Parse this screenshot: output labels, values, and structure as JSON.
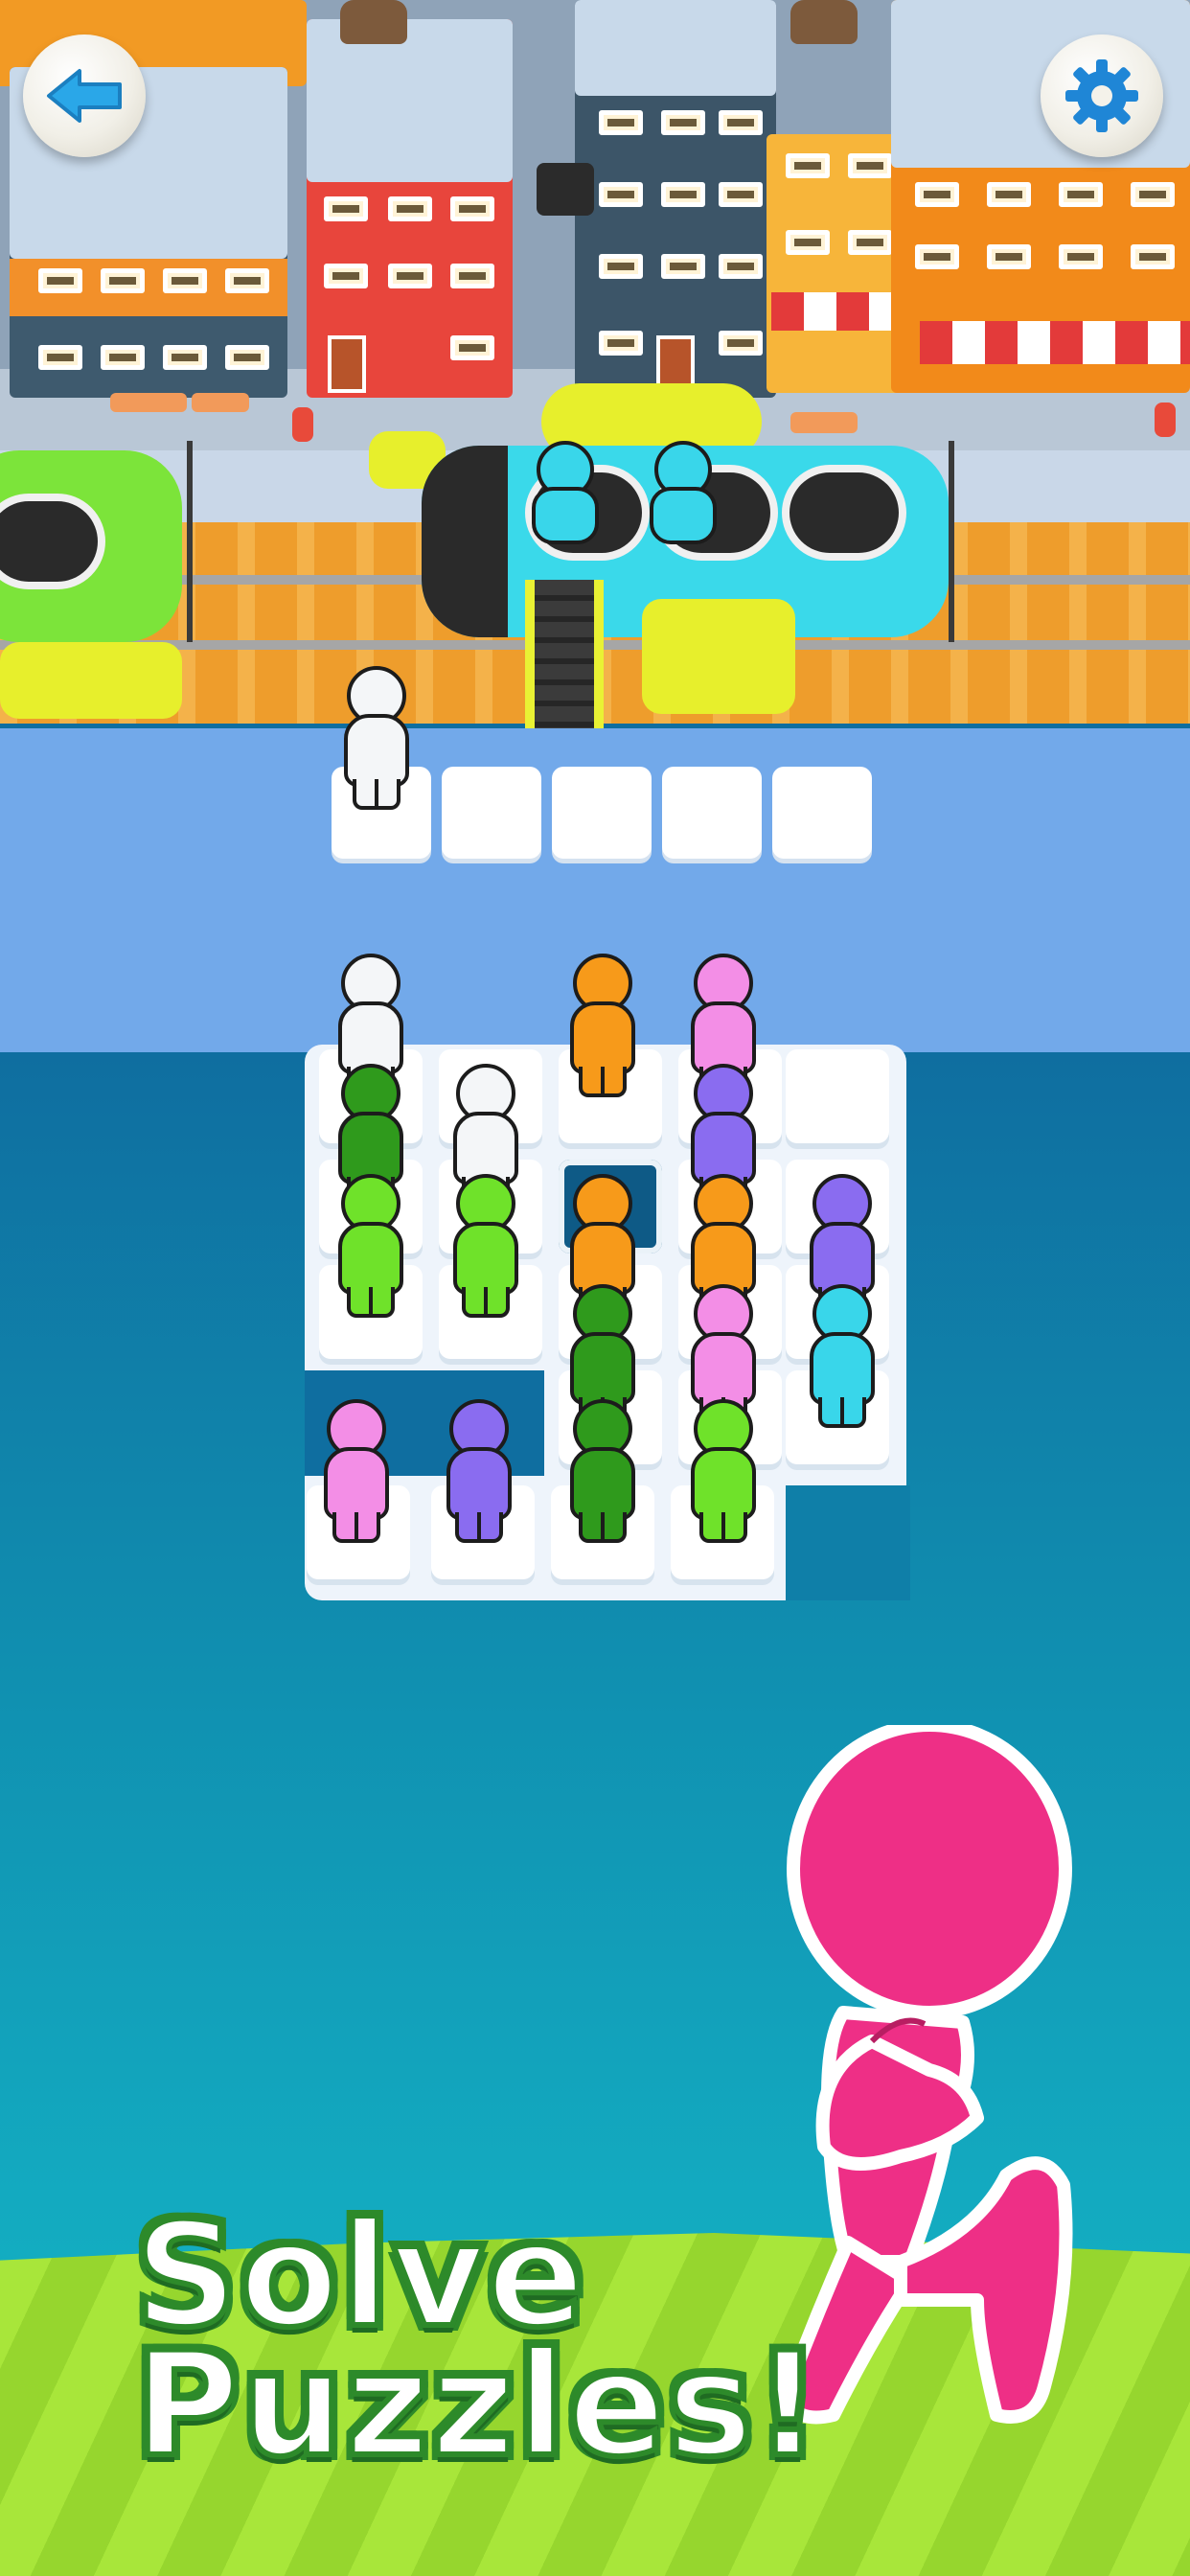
{
  "banner": {
    "line1": "Solve",
    "line2": "Puzzles!"
  },
  "hud": {
    "back_icon": "back-arrow-icon",
    "settings_icon": "gear-icon"
  },
  "colors": {
    "white": "#f4f6f8",
    "green_dark": "#2f9a1c",
    "green_light": "#6fe22a",
    "orange": "#f79a1a",
    "pink": "#f38ee6",
    "purple": "#8a6cf0",
    "cyan": "#39d6ea",
    "mascot": "#ee2f86",
    "grass": "#a8e63a",
    "banner_stroke": "#2d8a2a"
  },
  "queue": {
    "slots": 5,
    "waiting": [
      "white"
    ]
  },
  "train_passengers": [
    "cyan",
    "cyan"
  ],
  "board": {
    "people": [
      {
        "row": 0,
        "col": 0,
        "color": "white"
      },
      {
        "row": 0,
        "col": 2,
        "color": "orange"
      },
      {
        "row": 0,
        "col": 3,
        "color": "pink"
      },
      {
        "row": 1,
        "col": 0,
        "color": "green_dark"
      },
      {
        "row": 1,
        "col": 1,
        "color": "white"
      },
      {
        "row": 1,
        "col": 3,
        "color": "purple"
      },
      {
        "row": 2,
        "col": 0,
        "color": "green_light"
      },
      {
        "row": 2,
        "col": 1,
        "color": "green_light"
      },
      {
        "row": 2,
        "col": 2,
        "color": "orange"
      },
      {
        "row": 2,
        "col": 3,
        "color": "orange"
      },
      {
        "row": 2,
        "col": 4,
        "color": "purple"
      },
      {
        "row": 3,
        "col": 2,
        "color": "green_dark"
      },
      {
        "row": 3,
        "col": 3,
        "color": "pink"
      },
      {
        "row": 3,
        "col": 4,
        "color": "cyan"
      },
      {
        "row": 4,
        "col": 0,
        "color": "pink"
      },
      {
        "row": 4,
        "col": 1,
        "color": "purple"
      },
      {
        "row": 4,
        "col": 2,
        "color": "green_dark"
      },
      {
        "row": 4,
        "col": 3,
        "color": "green_light"
      }
    ]
  }
}
